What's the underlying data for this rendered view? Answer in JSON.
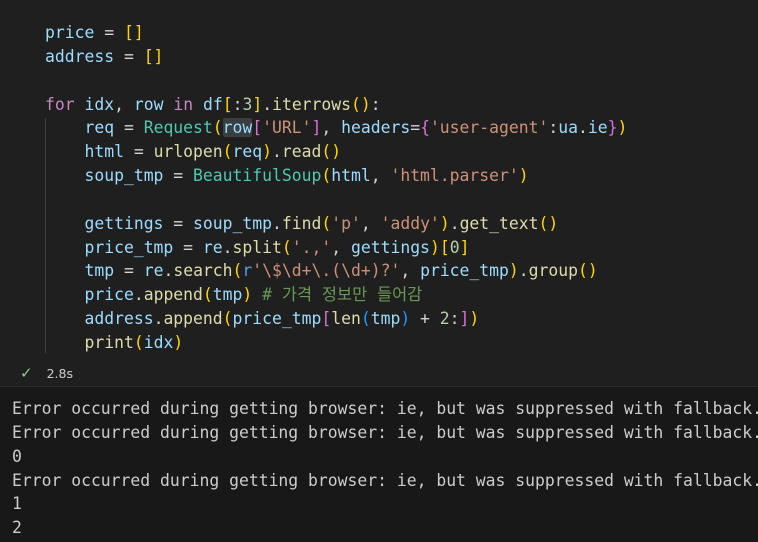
{
  "code_lines": [
    [
      [
        "var",
        "price"
      ],
      [
        "op",
        " = "
      ],
      [
        "b1",
        "[]"
      ]
    ],
    [
      [
        "var",
        "address"
      ],
      [
        "op",
        " = "
      ],
      [
        "b1",
        "[]"
      ]
    ],
    [],
    [
      [
        "kc",
        "for"
      ],
      [
        "op",
        " "
      ],
      [
        "var",
        "idx"
      ],
      [
        "op",
        ", "
      ],
      [
        "var",
        "row"
      ],
      [
        "op",
        " "
      ],
      [
        "kc",
        "in"
      ],
      [
        "op",
        " "
      ],
      [
        "var",
        "df"
      ],
      [
        "b1",
        "["
      ],
      [
        "op",
        ":"
      ],
      [
        "num",
        "3"
      ],
      [
        "b1",
        "]"
      ],
      [
        "op",
        "."
      ],
      [
        "fn",
        "iterrows"
      ],
      [
        "b1",
        "()"
      ],
      [
        "op",
        ":"
      ]
    ],
    [
      [
        "op",
        "    "
      ],
      [
        "var",
        "req"
      ],
      [
        "op",
        " = "
      ],
      [
        "cls",
        "Request"
      ],
      [
        "b1",
        "("
      ],
      [
        "var",
        "row",
        "hl"
      ],
      [
        "b2",
        "["
      ],
      [
        "str",
        "'URL'"
      ],
      [
        "b2",
        "]"
      ],
      [
        "op",
        ", "
      ],
      [
        "var",
        "headers"
      ],
      [
        "op",
        "="
      ],
      [
        "b2",
        "{"
      ],
      [
        "str",
        "'user-agent'"
      ],
      [
        "op",
        ":"
      ],
      [
        "var",
        "ua"
      ],
      [
        "op",
        "."
      ],
      [
        "var",
        "ie"
      ],
      [
        "b2",
        "}"
      ],
      [
        "b1",
        ")"
      ]
    ],
    [
      [
        "op",
        "    "
      ],
      [
        "var",
        "html"
      ],
      [
        "op",
        " = "
      ],
      [
        "fn",
        "urlopen"
      ],
      [
        "b1",
        "("
      ],
      [
        "var",
        "req"
      ],
      [
        "b1",
        ")"
      ],
      [
        "op",
        "."
      ],
      [
        "fn",
        "read"
      ],
      [
        "b1",
        "()"
      ]
    ],
    [
      [
        "op",
        "    "
      ],
      [
        "var",
        "soup_tmp"
      ],
      [
        "op",
        " = "
      ],
      [
        "cls",
        "BeautifulSoup"
      ],
      [
        "b1",
        "("
      ],
      [
        "var",
        "html"
      ],
      [
        "op",
        ", "
      ],
      [
        "str",
        "'html.parser'"
      ],
      [
        "b1",
        ")"
      ]
    ],
    [],
    [
      [
        "op",
        "    "
      ],
      [
        "var",
        "gettings"
      ],
      [
        "op",
        " = "
      ],
      [
        "var",
        "soup_tmp"
      ],
      [
        "op",
        "."
      ],
      [
        "fn",
        "find"
      ],
      [
        "b1",
        "("
      ],
      [
        "str",
        "'p'"
      ],
      [
        "op",
        ", "
      ],
      [
        "str",
        "'addy'"
      ],
      [
        "b1",
        ")"
      ],
      [
        "op",
        "."
      ],
      [
        "fn",
        "get_text"
      ],
      [
        "b1",
        "()"
      ]
    ],
    [
      [
        "op",
        "    "
      ],
      [
        "var",
        "price_tmp"
      ],
      [
        "op",
        " = "
      ],
      [
        "var",
        "re"
      ],
      [
        "op",
        "."
      ],
      [
        "fn",
        "split"
      ],
      [
        "b1",
        "("
      ],
      [
        "str",
        "'.,'"
      ],
      [
        "op",
        ", "
      ],
      [
        "var",
        "gettings"
      ],
      [
        "b1",
        ")"
      ],
      [
        "b1",
        "["
      ],
      [
        "num",
        "0"
      ],
      [
        "b1",
        "]"
      ]
    ],
    [
      [
        "op",
        "    "
      ],
      [
        "var",
        "tmp"
      ],
      [
        "op",
        " = "
      ],
      [
        "var",
        "re"
      ],
      [
        "op",
        "."
      ],
      [
        "fn",
        "search"
      ],
      [
        "b1",
        "("
      ],
      [
        "kw",
        "r"
      ],
      [
        "str",
        "'\\$\\d+\\.(\\d+)?'"
      ],
      [
        "op",
        ", "
      ],
      [
        "var",
        "price_tmp"
      ],
      [
        "b1",
        ")"
      ],
      [
        "op",
        "."
      ],
      [
        "fn",
        "group"
      ],
      [
        "b1",
        "()"
      ]
    ],
    [
      [
        "op",
        "    "
      ],
      [
        "var",
        "price"
      ],
      [
        "op",
        "."
      ],
      [
        "fn",
        "append"
      ],
      [
        "b1",
        "("
      ],
      [
        "var",
        "tmp"
      ],
      [
        "b1",
        ")"
      ],
      [
        "op",
        " "
      ],
      [
        "cm",
        "# 가격 정보만 들어감"
      ]
    ],
    [
      [
        "op",
        "    "
      ],
      [
        "var",
        "address"
      ],
      [
        "op",
        "."
      ],
      [
        "fn",
        "append"
      ],
      [
        "b1",
        "("
      ],
      [
        "var",
        "price_tmp"
      ],
      [
        "b2",
        "["
      ],
      [
        "fn",
        "len"
      ],
      [
        "b3",
        "("
      ],
      [
        "var",
        "tmp"
      ],
      [
        "b3",
        ")"
      ],
      [
        "op",
        " + "
      ],
      [
        "num",
        "2"
      ],
      [
        "op",
        ":"
      ],
      [
        "b2",
        "]"
      ],
      [
        "b1",
        ")"
      ]
    ],
    [
      [
        "op",
        "    "
      ],
      [
        "fn",
        "print"
      ],
      [
        "b1",
        "("
      ],
      [
        "var",
        "idx"
      ],
      [
        "b1",
        ")"
      ]
    ]
  ],
  "status": {
    "icon": "check-icon",
    "time": "2.8s"
  },
  "output_lines": [
    "Error occurred during getting browser: ie, but was suppressed with fallback.",
    "Error occurred during getting browser: ie, but was suppressed with fallback.",
    "0",
    "Error occurred during getting browser: ie, but was suppressed with fallback.",
    "1",
    "2"
  ]
}
